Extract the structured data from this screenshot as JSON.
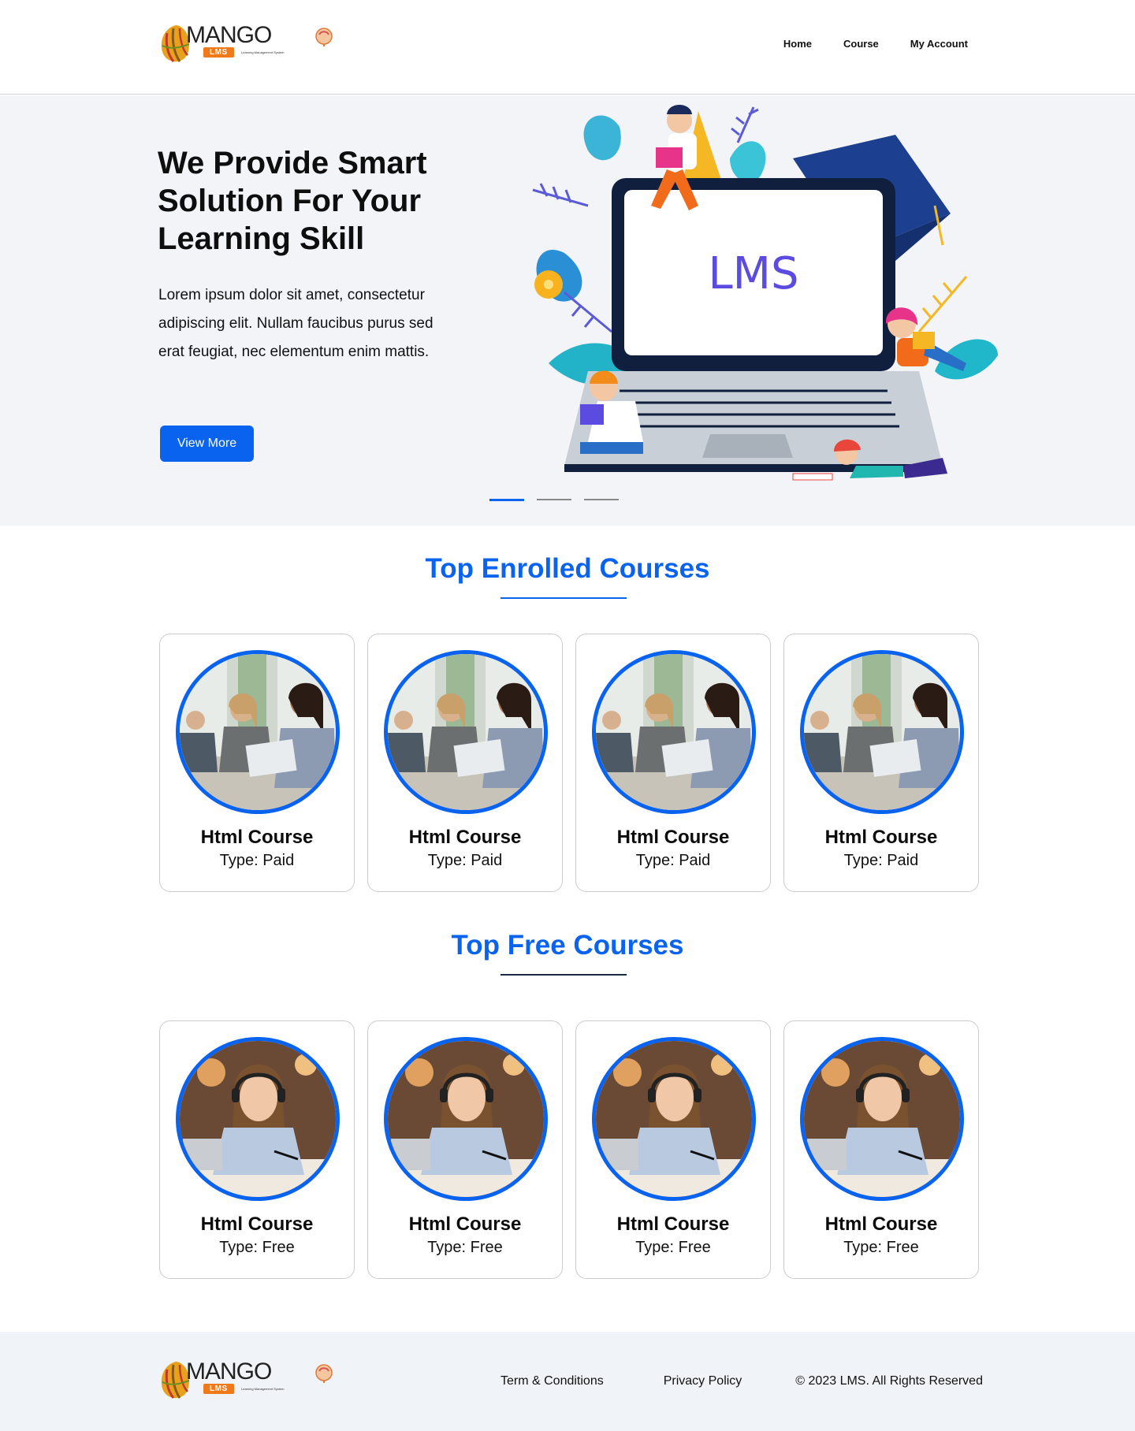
{
  "header": {
    "logo": {
      "word": "MANGO",
      "badge": "LMS",
      "tagline": "Learning Management System"
    },
    "nav": [
      {
        "label": "Home"
      },
      {
        "label": "Course"
      },
      {
        "label": "My Account"
      }
    ]
  },
  "hero": {
    "title": "We Provide Smart Solution For Your Learning Skill",
    "body": "Lorem ipsum dolor sit amet, consectetur adipiscing elit. Nullam faucibus purus sed erat feugiat, nec elementum enim mattis.",
    "button": "View More",
    "illustration_text": "LMS",
    "slides": {
      "count": 3,
      "active": 1
    }
  },
  "enrolled": {
    "title": "Top Enrolled Courses",
    "courses": [
      {
        "name": "Html Course",
        "type": "Type: Paid"
      },
      {
        "name": "Html Course",
        "type": "Type: Paid"
      },
      {
        "name": "Html Course",
        "type": "Type: Paid"
      },
      {
        "name": "Html Course",
        "type": "Type: Paid"
      }
    ]
  },
  "free": {
    "title": "Top Free Courses",
    "courses": [
      {
        "name": "Html Course",
        "type": "Type: Free"
      },
      {
        "name": "Html Course",
        "type": "Type: Free"
      },
      {
        "name": "Html Course",
        "type": "Type: Free"
      },
      {
        "name": "Html Course",
        "type": "Type: Free"
      }
    ]
  },
  "footer": {
    "logo": {
      "word": "MANGO",
      "badge": "LMS",
      "tagline": "Learning Management System"
    },
    "links": [
      {
        "label": "Term & Conditions"
      },
      {
        "label": "Privacy Policy"
      }
    ],
    "copyright": "© 2023 LMS. All Rights Reserved"
  },
  "colors": {
    "primary": "#0a63ef",
    "hero_bg": "#f2f4f8",
    "footer_bg": "#f0f3f8",
    "logo_orange": "#f07a1a"
  }
}
